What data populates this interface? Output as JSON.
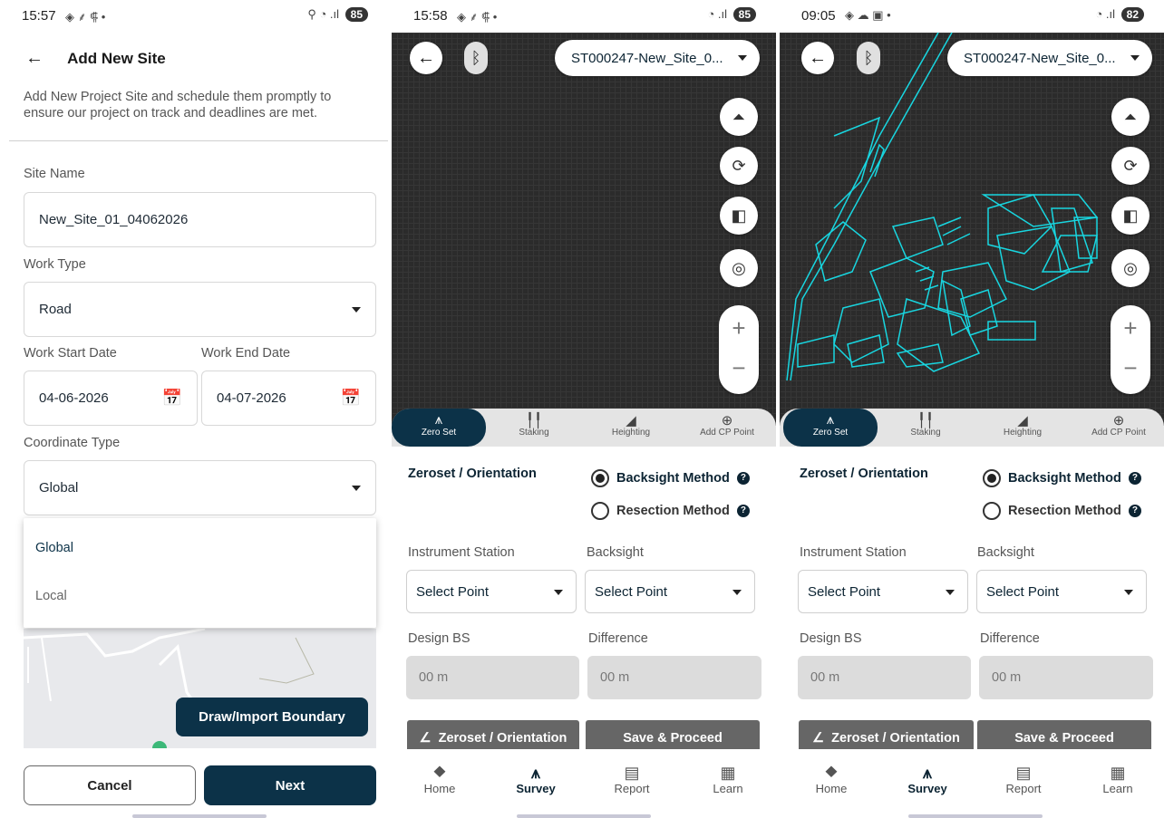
{
  "screen1": {
    "status": {
      "time": "15:57",
      "icons": "◈ ⸙ ⸿ •",
      "battery": "85"
    },
    "header": {
      "title": "Add New Site"
    },
    "description": "Add New Project Site and schedule them promptly to ensure our project on track and deadlines are met.",
    "site_name": {
      "label": "Site Name",
      "value": "New_Site_01_04062026"
    },
    "work_type": {
      "label": "Work Type",
      "value": "Road"
    },
    "start_date": {
      "label": "Work Start Date",
      "value": "04-06-2026"
    },
    "end_date": {
      "label": "Work End Date",
      "value": "04-07-2026"
    },
    "coordinate_type": {
      "label": "Coordinate Type",
      "value": "Global",
      "options": [
        "Global",
        "Local"
      ]
    },
    "boundary_button": "Draw/Import Boundary",
    "cancel_button": "Cancel",
    "next_button": "Next"
  },
  "screen2": {
    "status": {
      "time": "15:58",
      "icons": "◈ ⸙ ⸿ •",
      "battery": "85"
    },
    "site_selector": "ST000247-New_Site_0...",
    "tabs": [
      "Zero Set",
      "Staking",
      "Heighting",
      "Add CP Point"
    ],
    "section_title": "Zeroset / Orientation",
    "methods": [
      "Backsight Method",
      "Resection Method"
    ],
    "instrument_station": {
      "label": "Instrument Station",
      "value": "Select Point"
    },
    "backsight": {
      "label": "Backsight",
      "value": "Select Point"
    },
    "design_bs": {
      "label": "Design BS",
      "value": "00 m"
    },
    "difference": {
      "label": "Difference",
      "value": "00 m"
    },
    "zeroset_button": "Zeroset / Orientation",
    "save_button": "Save & Proceed",
    "nav": [
      "Home",
      "Survey",
      "Report",
      "Learn"
    ]
  },
  "screen3": {
    "status": {
      "time": "09:05",
      "icons": "◈ ☁ ▣ •",
      "battery": "82"
    },
    "site_selector": "ST000247-New_Site_0...",
    "tabs": [
      "Zero Set",
      "Staking",
      "Heighting",
      "Add CP Point"
    ],
    "section_title": "Zeroset / Orientation",
    "methods": [
      "Backsight Method",
      "Resection Method"
    ],
    "instrument_station": {
      "label": "Instrument Station",
      "value": "Select Point"
    },
    "backsight": {
      "label": "Backsight",
      "value": "Select Point"
    },
    "design_bs": {
      "label": "Design BS",
      "value": "00 m"
    },
    "difference": {
      "label": "Difference",
      "value": "00 m"
    },
    "zeroset_button": "Zeroset / Orientation",
    "save_button": "Save & Proceed",
    "nav": [
      "Home",
      "Survey",
      "Report",
      "Learn"
    ]
  },
  "icons": {
    "back": "arrow-left-icon",
    "calendar": "calendar-icon",
    "bluetooth": "bluetooth-icon",
    "map_controls": [
      "layers-up-icon",
      "rotate-icon",
      "compass-icon",
      "scan-icon"
    ],
    "nav": [
      "home-icon",
      "survey-icon",
      "report-icon",
      "learn-icon"
    ]
  },
  "colors": {
    "primary": "#0c3248",
    "map_bg": "#2b2b2b",
    "map_lines": "#18d6e0",
    "button_gray": "#666666"
  }
}
